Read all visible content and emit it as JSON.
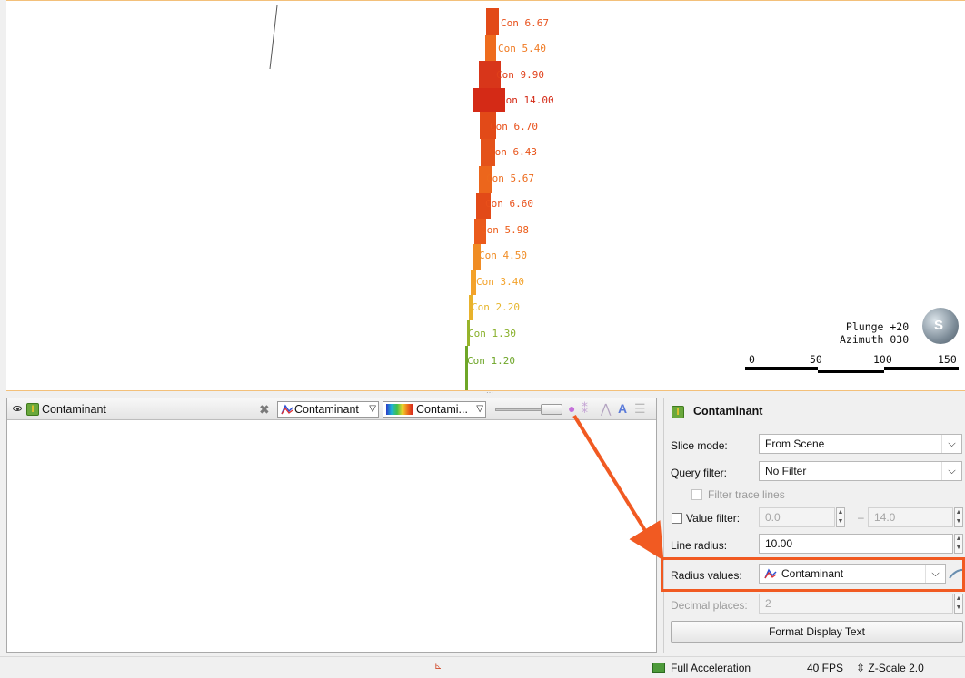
{
  "scene": {
    "labels": [
      {
        "text": "Con 6.67",
        "color": "#e8501a"
      },
      {
        "text": "Con 5.40",
        "color": "#f07a22"
      },
      {
        "text": "Con 9.90",
        "color": "#e0401a"
      },
      {
        "text": "Con 14.00",
        "color": "#d42a16"
      },
      {
        "text": "Con 6.70",
        "color": "#e8501a"
      },
      {
        "text": "Con 6.43",
        "color": "#e8541a"
      },
      {
        "text": "Con 5.67",
        "color": "#ec6a1c"
      },
      {
        "text": "Con 6.60",
        "color": "#e8501a"
      },
      {
        "text": "Con 5.98",
        "color": "#ec5e1b"
      },
      {
        "text": "Con 4.50",
        "color": "#f08c24"
      },
      {
        "text": "Con 3.40",
        "color": "#f3a22a"
      },
      {
        "text": "Con 2.20",
        "color": "#e6b52c"
      },
      {
        "text": "Con 1.30",
        "color": "#88b02a"
      },
      {
        "text": "Con 1.20",
        "color": "#6ea628"
      }
    ],
    "orientation": {
      "plunge": "Plunge +20",
      "azimuth": "Azimuth 030"
    },
    "compass_letter": "S",
    "scale_ticks": [
      "0",
      "50",
      "100",
      "150"
    ]
  },
  "left_panel": {
    "layer_title": "Contaminant",
    "radius_combo": "Contaminant",
    "colour_combo": "Contami...",
    "tool_icons": [
      "paint-icon",
      "radius-tool-icon",
      "graph-icon",
      "text-icon",
      "list-icon"
    ]
  },
  "right_panel": {
    "title": "Contaminant",
    "slice_mode": {
      "label": "Slice mode:",
      "value": "From Scene"
    },
    "query_filter": {
      "label": "Query filter:",
      "value": "No Filter"
    },
    "filter_trace_lines": "Filter trace lines",
    "value_filter": {
      "label": "Value filter:",
      "min": "0.0",
      "dash": "–",
      "max": "14.0"
    },
    "line_radius": {
      "label": "Line radius:",
      "value": "10.00"
    },
    "radius_values": {
      "label": "Radius values:",
      "value": "Contaminant"
    },
    "decimal_places": {
      "label": "Decimal places:",
      "value": "2"
    },
    "format_button": "Format Display Text"
  },
  "status_bar": {
    "acceleration": "Full Acceleration",
    "fps": "40 FPS",
    "zscale": "Z-Scale 2.0"
  },
  "colors": {
    "accent": "#f15a22",
    "highlight_border": "#f15a22"
  }
}
